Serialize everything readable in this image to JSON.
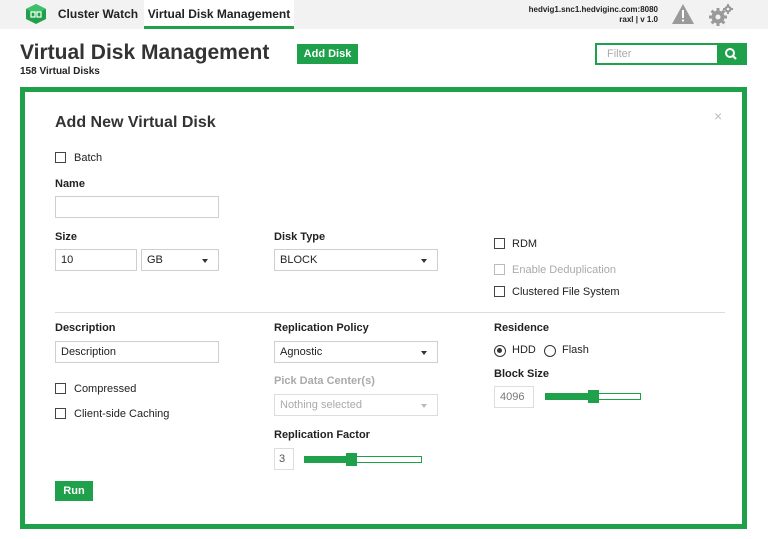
{
  "nav": {
    "tabs": [
      {
        "label": "Cluster Watch",
        "active": false
      },
      {
        "label": "Virtual Disk Management",
        "active": true
      }
    ],
    "host": "hedvig1.snc1.hedviginc.com:8080",
    "user_version": "raxl  |  v 1.0",
    "icons": [
      "logo-icon",
      "warning-icon",
      "gear-icon"
    ]
  },
  "header": {
    "title": "Virtual Disk Management",
    "count": "158 Virtual Disks",
    "add_button": "Add Disk",
    "filter_placeholder": "Filter"
  },
  "modal": {
    "title": "Add New Virtual Disk",
    "close": "×",
    "batch": {
      "label": "Batch",
      "checked": false
    },
    "name": {
      "label": "Name",
      "value": ""
    },
    "size": {
      "label": "Size",
      "value": "10",
      "unit": "GB"
    },
    "disk_type": {
      "label": "Disk Type",
      "value": "BLOCK"
    },
    "rdm": {
      "label": "RDM",
      "checked": false
    },
    "dedup": {
      "label": "Enable Deduplication",
      "checked": false,
      "disabled": true
    },
    "clustered_fs": {
      "label": "Clustered File System",
      "checked": false
    },
    "description": {
      "label": "Description",
      "value": "Description"
    },
    "compressed": {
      "label": "Compressed",
      "checked": false
    },
    "client_caching": {
      "label": "Client-side Caching",
      "checked": false
    },
    "replication_policy": {
      "label": "Replication Policy",
      "value": "Agnostic"
    },
    "pick_dc": {
      "label": "Pick Data Center(s)",
      "value": "Nothing selected",
      "disabled": true
    },
    "replication_factor": {
      "label": "Replication Factor",
      "value": "3",
      "slider_fraction": 0.4
    },
    "residence": {
      "label": "Residence",
      "options": [
        "HDD",
        "Flash"
      ],
      "selected": "HDD"
    },
    "block_size": {
      "label": "Block Size",
      "value": "4096",
      "slider_fraction": 0.5
    },
    "run_button": "Run"
  },
  "colors": {
    "accent": "#1fa04b",
    "topbar": "#f2f2f2",
    "icon_gray": "#9a9a9a"
  }
}
